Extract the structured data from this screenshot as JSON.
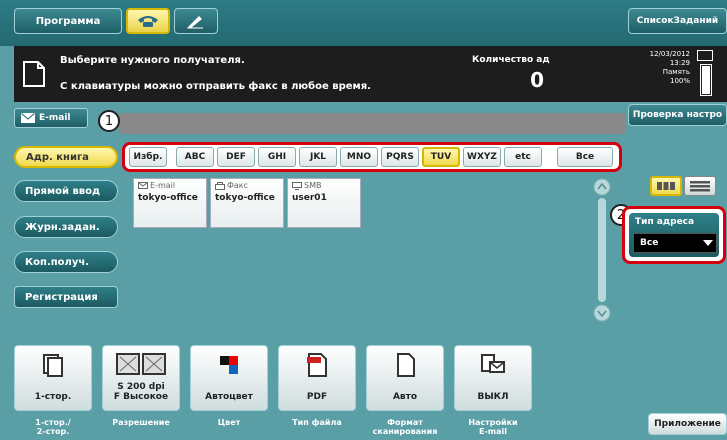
{
  "topbar": {
    "program_label": "Программа",
    "jobs_label": "СписокЗаданий",
    "tabs": [
      {
        "icon": "telephone-icon",
        "selected": true
      },
      {
        "icon": "pen-icon",
        "selected": false
      }
    ]
  },
  "message": {
    "line1": "Выберите нужного получателя.",
    "line2": "С клавиатуры можно отправить факс в любое время.",
    "quantity_label": "Количество ад",
    "quantity_value": "0",
    "date": "12/03/2012",
    "time": "13:29",
    "memory_label": "Память",
    "memory_value": "100%",
    "memory_fraction": 1.0
  },
  "email_tab": {
    "label": "E-mail",
    "icon": "envelope-icon"
  },
  "check_settings_label": "Проверка настро",
  "callouts": {
    "one": "1",
    "two": "2"
  },
  "nav": {
    "addr_book": "Адр. книга",
    "direct": "Прямой ввод",
    "journal": "Журн.задан.",
    "multi": "Коп.получ.",
    "register": "Регистрация"
  },
  "index_tabs": [
    "Избр.",
    "ABC",
    "DEF",
    "GHI",
    "JKL",
    "MNO",
    "PQRS",
    "TUV",
    "WXYZ",
    "etc",
    "Все"
  ],
  "index_selected": "TUV",
  "destinations": [
    {
      "type": "E-mail",
      "name": "tokyo-office",
      "icon": "email-icon"
    },
    {
      "type": "Факс",
      "name": "tokyo-office",
      "icon": "fax-icon"
    },
    {
      "type": "SMB",
      "name": "user01",
      "icon": "smb-icon"
    }
  ],
  "address_type": {
    "label": "Тип адреса",
    "value": "Все"
  },
  "settings": [
    {
      "value": "1-стор.",
      "caption": "1-стор./\n2-стор.",
      "icon": "duplex-icon"
    },
    {
      "value": "S 200 dpi\nF Высокое",
      "caption": "Разрешение",
      "icon": "resolution-icon"
    },
    {
      "value": "Автоцвет",
      "caption": "Цвет",
      "icon": "color-icon"
    },
    {
      "value": "PDF",
      "caption": "Тип файла",
      "icon": "pdf-icon"
    },
    {
      "value": "Авто",
      "caption": "Формат\nсканирования",
      "icon": "page-icon"
    },
    {
      "value": "ВЫКЛ",
      "caption": "Настройки\nE-mail",
      "icon": "email-settings-icon"
    }
  ],
  "apps_label": "Приложение",
  "colors": {
    "accent": "#d4000d",
    "selected": "#f0d94e",
    "panel": "#5a9ea6",
    "message_bg": "#1d1d1d"
  }
}
